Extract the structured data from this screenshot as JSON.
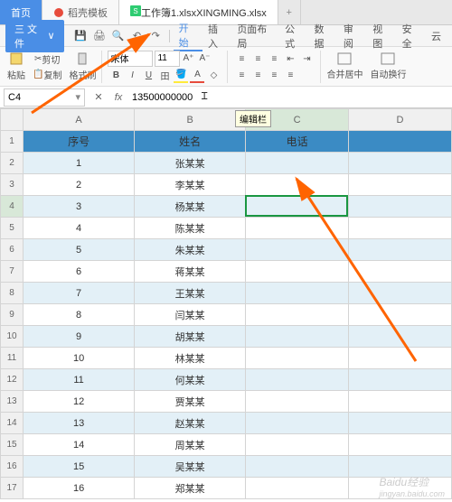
{
  "tabs": {
    "home": "首页",
    "template": "稻壳模板",
    "file": "工作簿1.xlsxXINGMING.xlsx"
  },
  "menu": {
    "file": "三 文件",
    "items": [
      "开始",
      "插入",
      "页面布局",
      "公式",
      "数据",
      "审阅",
      "视图",
      "安全",
      "云"
    ]
  },
  "ribbon": {
    "paste": "粘贴",
    "copy": "复制",
    "cut": "剪切",
    "format": "格式刷",
    "font": "宋体",
    "size": "11",
    "merge": "合并居中",
    "wrap": "自动换行"
  },
  "formula": {
    "cell": "C4",
    "value": "13500000000"
  },
  "tooltip": "编辑栏",
  "columns": [
    "A",
    "B",
    "C",
    "D"
  ],
  "header": {
    "a": "序号",
    "b": "姓名",
    "c": "电话"
  },
  "rows": [
    {
      "n": "1",
      "name": "张某某"
    },
    {
      "n": "2",
      "name": "李某某"
    },
    {
      "n": "3",
      "name": "杨某某"
    },
    {
      "n": "4",
      "name": "陈某某"
    },
    {
      "n": "5",
      "name": "朱某某"
    },
    {
      "n": "6",
      "name": "蒋某某"
    },
    {
      "n": "7",
      "name": "王某某"
    },
    {
      "n": "8",
      "name": "闫某某"
    },
    {
      "n": "9",
      "name": "胡某某"
    },
    {
      "n": "10",
      "name": "林某某"
    },
    {
      "n": "11",
      "name": "何某某"
    },
    {
      "n": "12",
      "name": "贾某某"
    },
    {
      "n": "13",
      "name": "赵某某"
    },
    {
      "n": "14",
      "name": "周某某"
    },
    {
      "n": "15",
      "name": "吴某某"
    },
    {
      "n": "16",
      "name": "郑某某"
    }
  ],
  "watermark": {
    "brand": "Baidu经验",
    "url": "jingyan.baidu.com"
  }
}
